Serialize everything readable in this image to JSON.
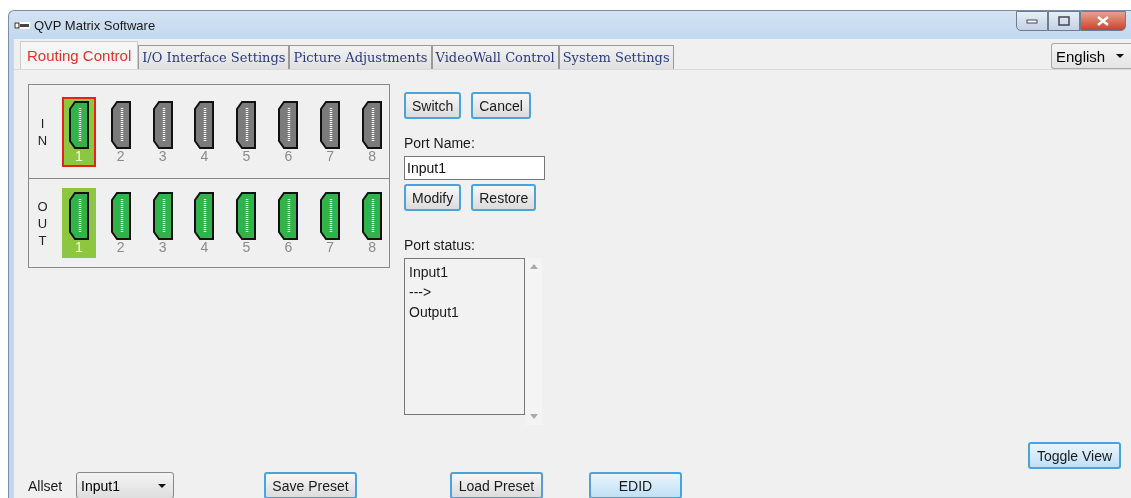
{
  "window": {
    "title": "QVP Matrix Software"
  },
  "tabs": [
    {
      "label": "Routing Control",
      "selected": true
    },
    {
      "label": "I/O Interface Settings",
      "selected": false
    },
    {
      "label": "Picture Adjustments",
      "selected": false
    },
    {
      "label": "VideoWall Control",
      "selected": false
    },
    {
      "label": "System Settings",
      "selected": false
    }
  ],
  "language": {
    "value": "English"
  },
  "inputs": {
    "label": [
      "I",
      "N"
    ],
    "ports": [
      {
        "number": "1",
        "connected": true,
        "selected": true
      },
      {
        "number": "2",
        "connected": false,
        "selected": false
      },
      {
        "number": "3",
        "connected": false,
        "selected": false
      },
      {
        "number": "4",
        "connected": false,
        "selected": false
      },
      {
        "number": "5",
        "connected": false,
        "selected": false
      },
      {
        "number": "6",
        "connected": false,
        "selected": false
      },
      {
        "number": "7",
        "connected": false,
        "selected": false
      },
      {
        "number": "8",
        "connected": false,
        "selected": false
      }
    ]
  },
  "outputs": {
    "label": [
      "O",
      "U",
      "T"
    ],
    "ports": [
      {
        "number": "1",
        "connected": true,
        "selected": true
      },
      {
        "number": "2",
        "connected": true,
        "selected": false
      },
      {
        "number": "3",
        "connected": true,
        "selected": false
      },
      {
        "number": "4",
        "connected": true,
        "selected": false
      },
      {
        "number": "5",
        "connected": true,
        "selected": false
      },
      {
        "number": "6",
        "connected": true,
        "selected": false
      },
      {
        "number": "7",
        "connected": true,
        "selected": false
      },
      {
        "number": "8",
        "connected": true,
        "selected": false
      }
    ]
  },
  "switch_buttons": [
    "Switch",
    "Cancel"
  ],
  "port_name": {
    "label": "Port Name:",
    "value": "Input1"
  },
  "name_buttons": [
    "Modify",
    "Restore"
  ],
  "port_status": {
    "label": "Port status:",
    "lines": [
      "Input1",
      "--->",
      "Output1"
    ]
  },
  "allset": {
    "label": "Allset",
    "value": "Input1"
  },
  "bottom_buttons": [
    "Save Preset",
    "Load Preset",
    "EDID"
  ],
  "toggle_button": "Toggle View"
}
